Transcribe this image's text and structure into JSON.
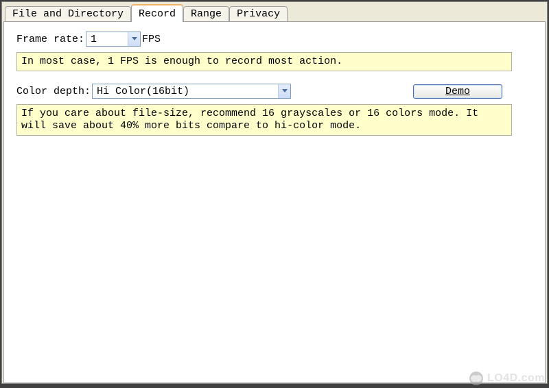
{
  "tabs": [
    {
      "label": "File and Directory"
    },
    {
      "label": "Record"
    },
    {
      "label": "Range"
    },
    {
      "label": "Privacy"
    }
  ],
  "active_tab_index": 1,
  "record": {
    "frame_rate_label": "Frame rate:",
    "frame_rate_value": "1",
    "frame_rate_suffix": "FPS",
    "frame_rate_hint": "In most case, 1 FPS is enough to record most action.",
    "color_depth_label": "Color depth:",
    "color_depth_value": "Hi Color(16bit)",
    "demo_button": "Demo",
    "color_depth_hint": "If you care about file-size, recommend 16 grayscales or 16 colors mode. It will save about 40%  more bits compare to hi-color mode."
  },
  "watermark": "LO4D.com"
}
